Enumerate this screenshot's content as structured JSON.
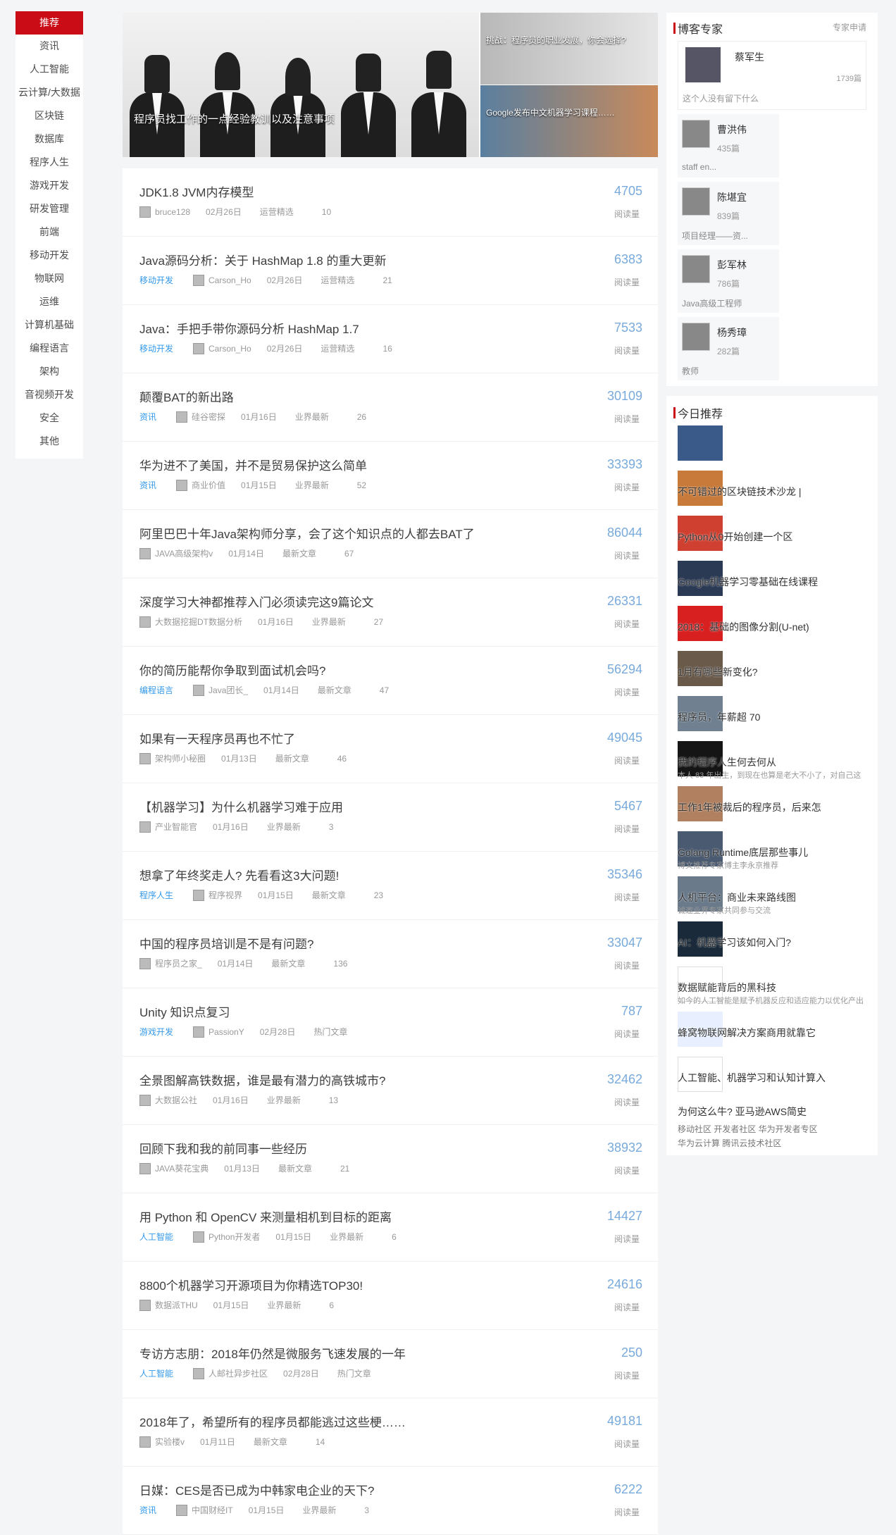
{
  "nav": [
    "推荐",
    "资讯",
    "人工智能",
    "云计算/大数据",
    "区块链",
    "数据库",
    "程序人生",
    "游戏开发",
    "研发管理",
    "前端",
    "移动开发",
    "物联网",
    "运维",
    "计算机基础",
    "编程语言",
    "架构",
    "音视频开发",
    "安全",
    "其他"
  ],
  "banner": {
    "main": "程序员找工作的一点经验教训以及注意事项",
    "small1": "挑战：程序员的职业发展，你会选择?",
    "small2": "Google发布中文机器学习课程……"
  },
  "articles": [
    {
      "title": "JDK1.8 JVM内存模型",
      "category": "",
      "author": "bruce128",
      "date": "02月26日",
      "tag": "运营精选",
      "comments": "10",
      "reads": "4705"
    },
    {
      "title": "Java源码分析：关于 HashMap 1.8 的重大更新",
      "category": "移动开发",
      "author": "Carson_Ho",
      "date": "02月26日",
      "tag": "运营精选",
      "comments": "21",
      "reads": "6383"
    },
    {
      "title": "Java：手把手带你源码分析 HashMap 1.7",
      "category": "移动开发",
      "author": "Carson_Ho",
      "date": "02月26日",
      "tag": "运营精选",
      "comments": "16",
      "reads": "7533"
    },
    {
      "title": "颠覆BAT的新出路",
      "category": "资讯",
      "author": "硅谷密探",
      "date": "01月16日",
      "tag": "业界最新",
      "comments": "26",
      "reads": "30109"
    },
    {
      "title": "华为进不了美国，并不是贸易保护这么简单",
      "category": "资讯",
      "author": "商业价值",
      "date": "01月15日",
      "tag": "业界最新",
      "comments": "52",
      "reads": "33393"
    },
    {
      "title": "阿里巴巴十年Java架构师分享，会了这个知识点的人都去BAT了",
      "category": "",
      "author": "JAVA高级架构v",
      "date": "01月14日",
      "tag": "最新文章",
      "comments": "67",
      "reads": "86044"
    },
    {
      "title": "深度学习大神都推荐入门必须读完这9篇论文",
      "category": "",
      "author": "大数据挖掘DT数据分析",
      "date": "01月16日",
      "tag": "业界最新",
      "comments": "27",
      "reads": "26331"
    },
    {
      "title": "你的简历能帮你争取到面试机会吗?",
      "category": "编程语言",
      "author": "Java团长_",
      "date": "01月14日",
      "tag": "最新文章",
      "comments": "47",
      "reads": "56294"
    },
    {
      "title": "如果有一天程序员再也不忙了",
      "category": "",
      "author": "架构师小秘圈",
      "date": "01月13日",
      "tag": "最新文章",
      "comments": "46",
      "reads": "49045"
    },
    {
      "title": "【机器学习】为什么机器学习难于应用",
      "category": "",
      "author": "产业智能官",
      "date": "01月16日",
      "tag": "业界最新",
      "comments": "3",
      "reads": "5467"
    },
    {
      "title": "想拿了年终奖走人? 先看看这3大问题!",
      "category": "程序人生",
      "author": "程序视界",
      "date": "01月15日",
      "tag": "最新文章",
      "comments": "23",
      "reads": "35346"
    },
    {
      "title": "中国的程序员培训是不是有问题?",
      "category": "",
      "author": "程序员之家_",
      "date": "01月14日",
      "tag": "最新文章",
      "comments": "136",
      "reads": "33047"
    },
    {
      "title": "Unity 知识点复习",
      "category": "游戏开发",
      "author": "PassionY",
      "date": "02月28日",
      "tag": "热门文章",
      "comments": "",
      "reads": "787"
    },
    {
      "title": "全景图解高铁数据，谁是最有潜力的高铁城市?",
      "category": "",
      "author": "大数据公社",
      "date": "01月16日",
      "tag": "业界最新",
      "comments": "13",
      "reads": "32462"
    },
    {
      "title": "回顾下我和我的前同事一些经历",
      "category": "",
      "author": "JAVA葵花宝典",
      "date": "01月13日",
      "tag": "最新文章",
      "comments": "21",
      "reads": "38932"
    },
    {
      "title": "用 Python 和 OpenCV 来测量相机到目标的距离",
      "category": "人工智能",
      "author": "Python开发者",
      "date": "01月15日",
      "tag": "业界最新",
      "comments": "6",
      "reads": "14427"
    },
    {
      "title": "8800个机器学习开源项目为你精选TOP30!",
      "category": "",
      "author": "数据派THU",
      "date": "01月15日",
      "tag": "业界最新",
      "comments": "6",
      "reads": "24616"
    },
    {
      "title": "专访方志朋：2018年仍然是微服务飞速发展的一年",
      "category": "人工智能",
      "author": "人邮社异步社区",
      "date": "02月28日",
      "tag": "热门文章",
      "comments": "",
      "reads": "250"
    },
    {
      "title": "2018年了，希望所有的程序员都能逃过这些梗……",
      "category": "",
      "author": "实验楼v",
      "date": "01月11日",
      "tag": "最新文章",
      "comments": "14",
      "reads": "49181"
    },
    {
      "title": "日媒：CES是否已成为中韩家电企业的天下?",
      "category": "资讯",
      "author": "中国财经IT",
      "date": "01月15日",
      "tag": "业界最新",
      "comments": "3",
      "reads": "6222"
    }
  ],
  "read_label": "阅读量",
  "experts": {
    "title": "博客专家",
    "apply": "专家申请",
    "top": {
      "name": "蔡军生",
      "count": "1739篇",
      "desc": "这个人没有留下什么"
    },
    "list": [
      {
        "name": "曹洪伟",
        "count": "435篇",
        "desc": "staff en..."
      },
      {
        "name": "陈堪宜",
        "count": "839篇",
        "desc": "项目经理——资..."
      },
      {
        "name": "彭军林",
        "count": "786篇",
        "desc": "Java高级工程师"
      },
      {
        "name": "杨秀璋",
        "count": "282篇",
        "desc": "教师"
      }
    ]
  },
  "today": {
    "title": "今日推荐",
    "items": [
      {
        "text": "",
        "sub": "",
        "color": "#3a5a8a"
      },
      {
        "text": "不可错过的区块链技术沙龙 |",
        "sub": "",
        "color": "#c87a3a"
      },
      {
        "text": "Python从0开始创建一个区",
        "sub": "",
        "color": "#d04030"
      },
      {
        "text": "Google机器学习零基础在线课程",
        "sub": "",
        "color": "#2a3a55"
      },
      {
        "text": "2018：基础的图像分割(U-net)",
        "sub": "",
        "color": "#d82020"
      },
      {
        "text": "1月有哪些新变化?",
        "sub": "",
        "color": "#6a5a4a"
      },
      {
        "text": "程序员，年薪超 70",
        "sub": "",
        "color": "#708090"
      },
      {
        "text": "我的程序人生何去何从",
        "sub": "本人 83 年出生，到现在也算是老大不小了，对自己这",
        "color": "#151515"
      },
      {
        "text": "工作1年被裁后的程序员，后来怎",
        "sub": "",
        "color": "#b08060"
      },
      {
        "text": "Golang Runtime底层那些事儿",
        "sub": "博文推荐专家博主李永京推荐",
        "color": "#4a5a70"
      },
      {
        "text": "人机平台：商业未来路线图",
        "sub": "诚邀业界专家共同参与交流",
        "color": "#6a7a8a"
      },
      {
        "text": "AI：机器学习该如何入门?",
        "sub": "",
        "color": "#1a2a3a"
      },
      {
        "text": "数据赋能背后的黑科技",
        "sub": "如今的人工智能是赋予机器反应和适应能力以优化产出",
        "color": "#ffffff"
      },
      {
        "text": "蜂窝物联网解决方案商用就靠它",
        "sub": "",
        "color": "#e8f0ff"
      },
      {
        "text": "人工智能、机器学习和认知计算入",
        "sub": "",
        "color": "#ffffff"
      }
    ],
    "ad": "为何这么牛? 亚马逊AWS简史",
    "links1": "移动社区  开发者社区  华为开发者专区",
    "links2": "华为云计算  腾讯云技术社区"
  }
}
